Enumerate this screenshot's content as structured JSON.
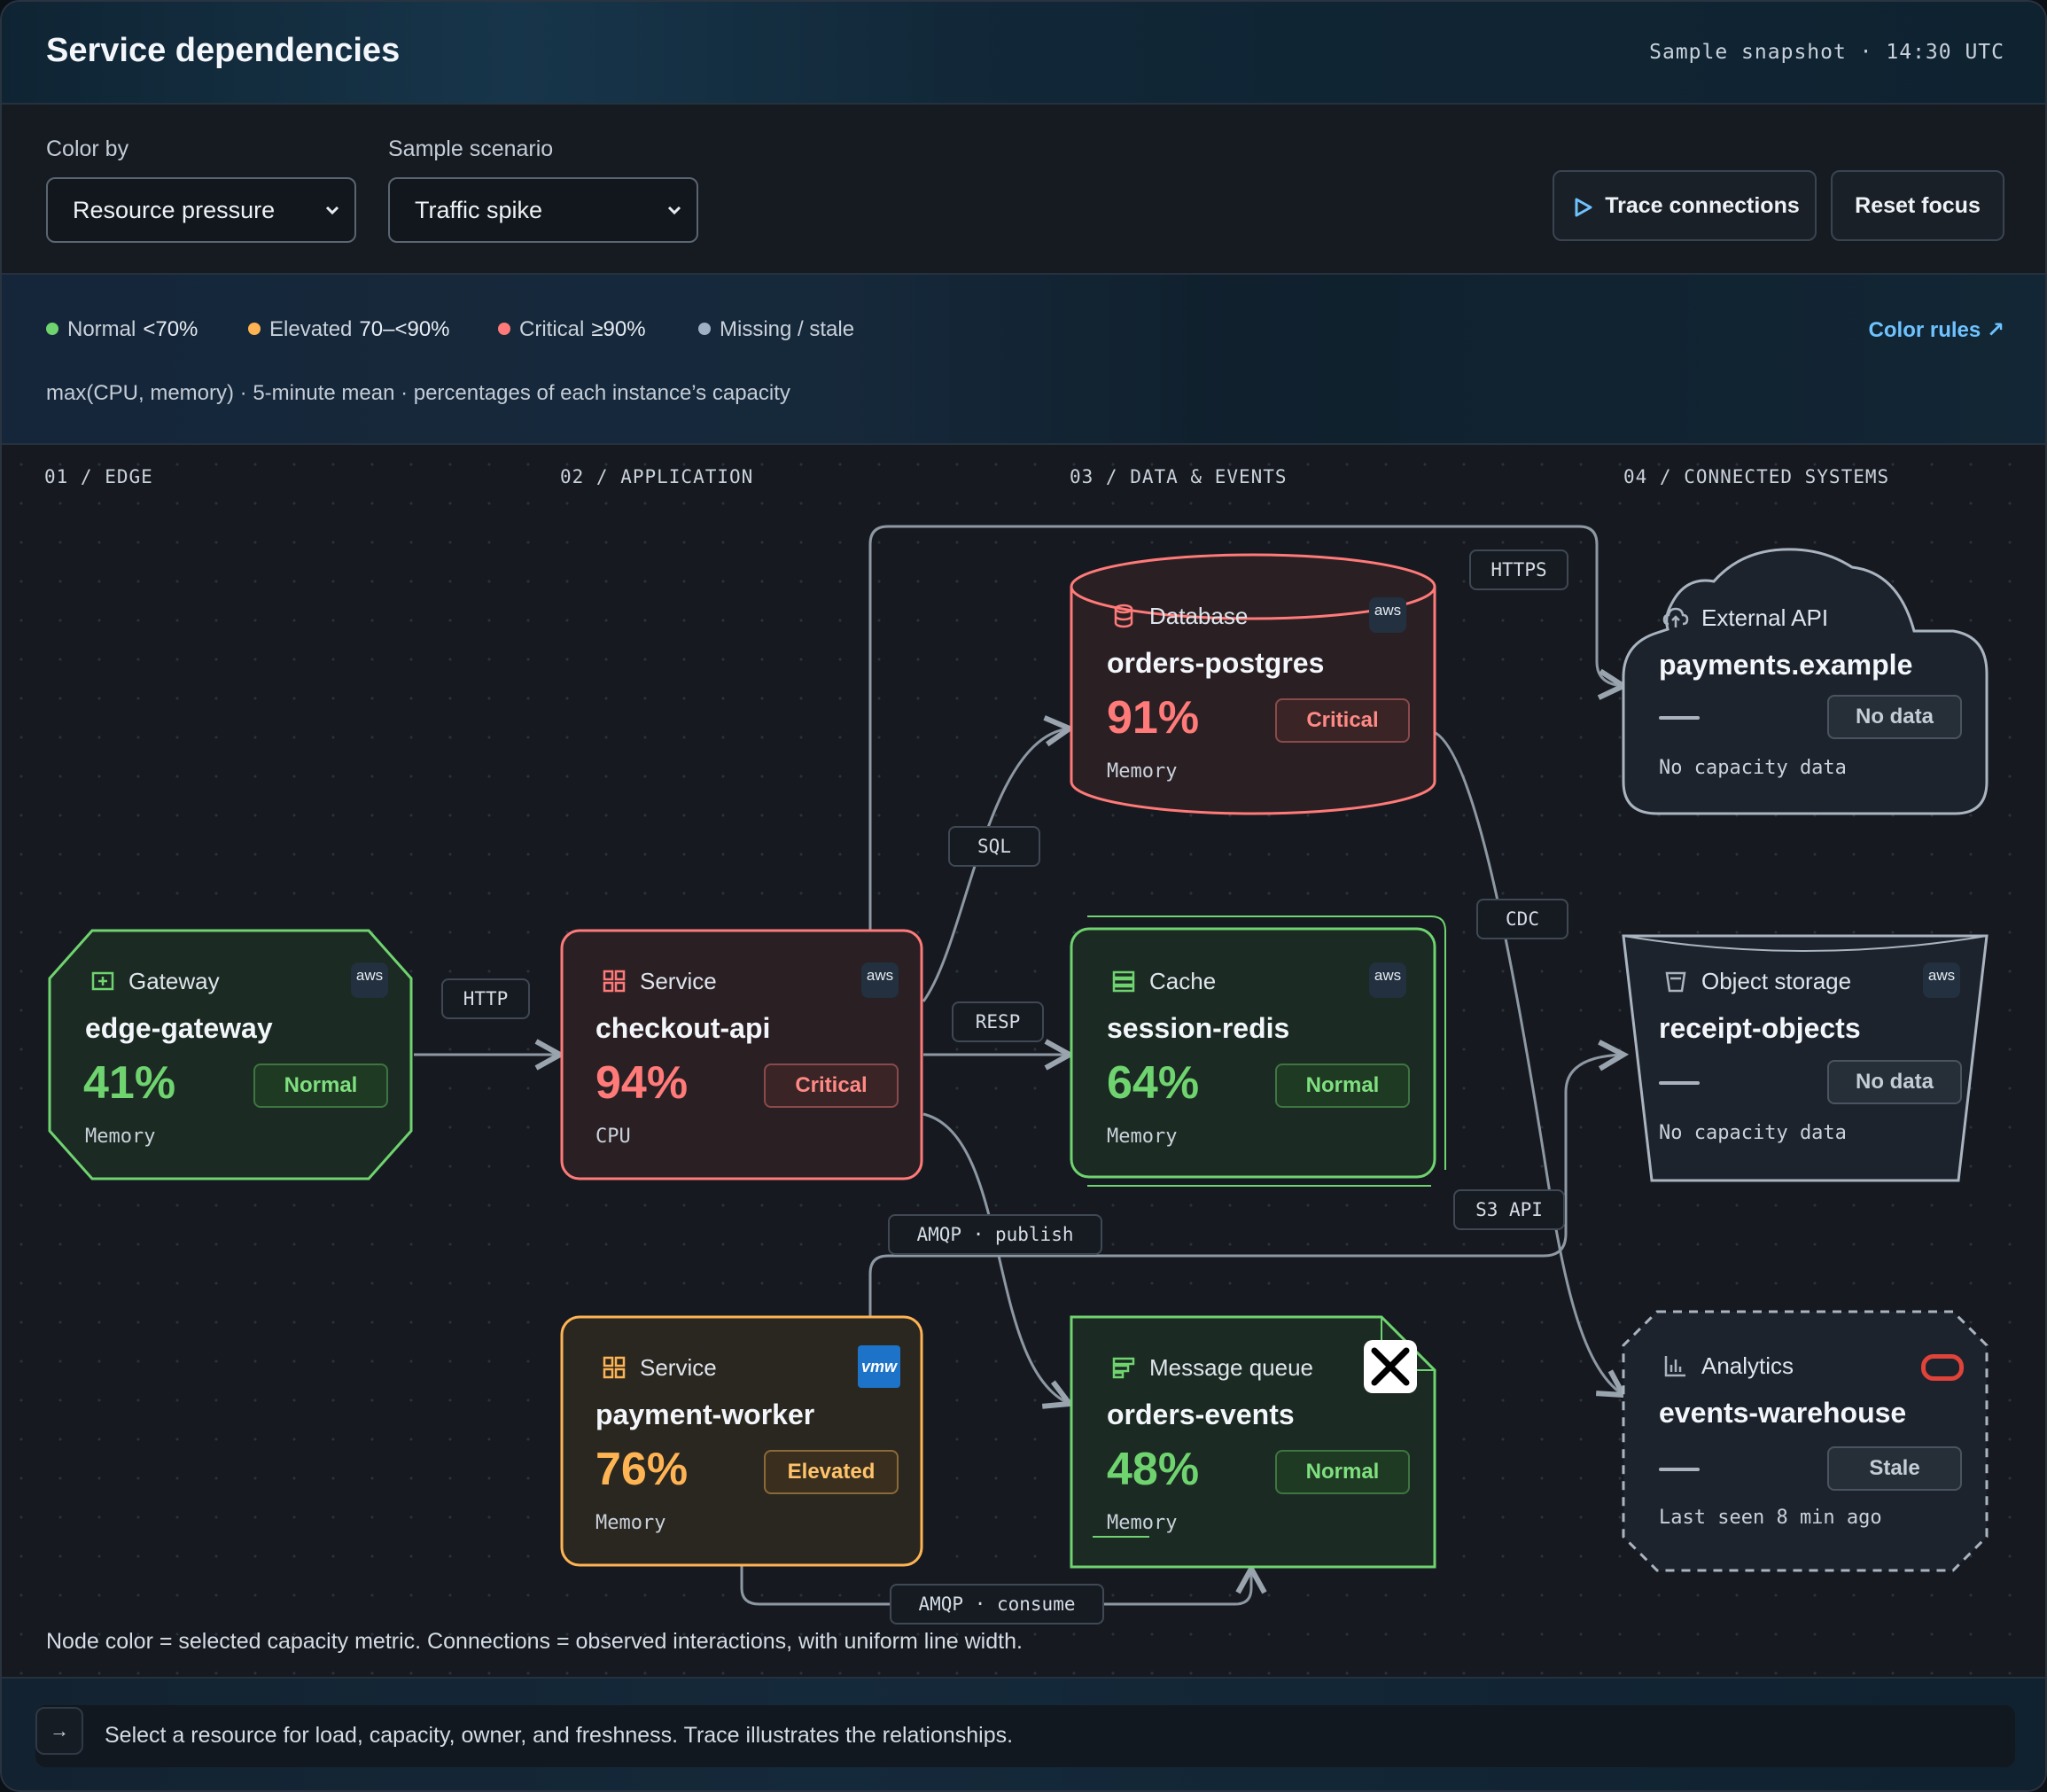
{
  "header": {
    "title": "Service dependencies",
    "snapshot": "Sample snapshot · 14:30 UTC"
  },
  "controls": {
    "color_by_label": "Color by",
    "color_by_value": "Resource pressure",
    "scenario_label": "Sample scenario",
    "scenario_value": "Traffic spike",
    "trace_button": "Trace connections",
    "reset_button": "Reset focus"
  },
  "legend": {
    "items": [
      {
        "label": "Normal",
        "threshold": "<70%",
        "color": "#6fd36f"
      },
      {
        "label": "Elevated",
        "threshold": "70–<90%",
        "color": "#ffb454"
      },
      {
        "label": "Critical",
        "threshold": "≥90%",
        "color": "#ff7a78"
      },
      {
        "label": "Missing / stale",
        "threshold": "",
        "color": "#9fb0c4"
      }
    ],
    "formula": "max(CPU, memory) · 5-minute mean · percentages of each instance’s capacity",
    "color_rules_link": "Color rules ↗"
  },
  "columns": [
    "01 / EDGE",
    "02 / APPLICATION",
    "03 / DATA & EVENTS",
    "04 / CONNECTED SYSTEMS"
  ],
  "edges": {
    "http": "HTTP",
    "sql": "SQL",
    "resp": "RESP",
    "https": "HTTPS",
    "cdc": "CDC",
    "s3": "S3 API",
    "amqp_publish": "AMQP · publish",
    "amqp_consume": "AMQP · consume"
  },
  "nodes": {
    "edge_gateway": {
      "kind": "Gateway",
      "name": "edge-gateway",
      "value": "41%",
      "status": "Normal",
      "metric": "Memory",
      "provider": "aws"
    },
    "checkout_api": {
      "kind": "Service",
      "name": "checkout-api",
      "value": "94%",
      "status": "Critical",
      "metric": "CPU",
      "provider": "aws"
    },
    "payment_worker": {
      "kind": "Service",
      "name": "payment-worker",
      "value": "76%",
      "status": "Elevated",
      "metric": "Memory",
      "provider": "vmw"
    },
    "orders_postgres": {
      "kind": "Database",
      "name": "orders-postgres",
      "value": "91%",
      "status": "Critical",
      "metric": "Memory",
      "provider": "aws"
    },
    "session_redis": {
      "kind": "Cache",
      "name": "session-redis",
      "value": "64%",
      "status": "Normal",
      "metric": "Memory",
      "provider": "aws"
    },
    "orders_events": {
      "kind": "Message queue",
      "name": "orders-events",
      "value": "48%",
      "status": "Normal",
      "metric": "Memory",
      "provider": "x"
    },
    "payments_example": {
      "kind": "External API",
      "name": "payments.example",
      "status": "No data",
      "metric": "No capacity data"
    },
    "receipt_objects": {
      "kind": "Object storage",
      "name": "receipt-objects",
      "status": "No data",
      "metric": "No capacity data",
      "provider": "aws"
    },
    "events_warehouse": {
      "kind": "Analytics",
      "name": "events-warehouse",
      "status": "Stale",
      "metric": "Last seen 8 min ago",
      "provider": "oracle"
    }
  },
  "footer_note": "Node color = selected capacity metric. Connections = observed interactions, with uniform line width.",
  "status_message": "Select a resource for load, capacity, owner, and freshness. Trace illustrates the relationships.",
  "colors": {
    "normal": "#6fd36f",
    "elevated": "#ffb454",
    "critical": "#ff7a78",
    "missing": "#9fb0c4",
    "link": "#6ec3ff"
  }
}
